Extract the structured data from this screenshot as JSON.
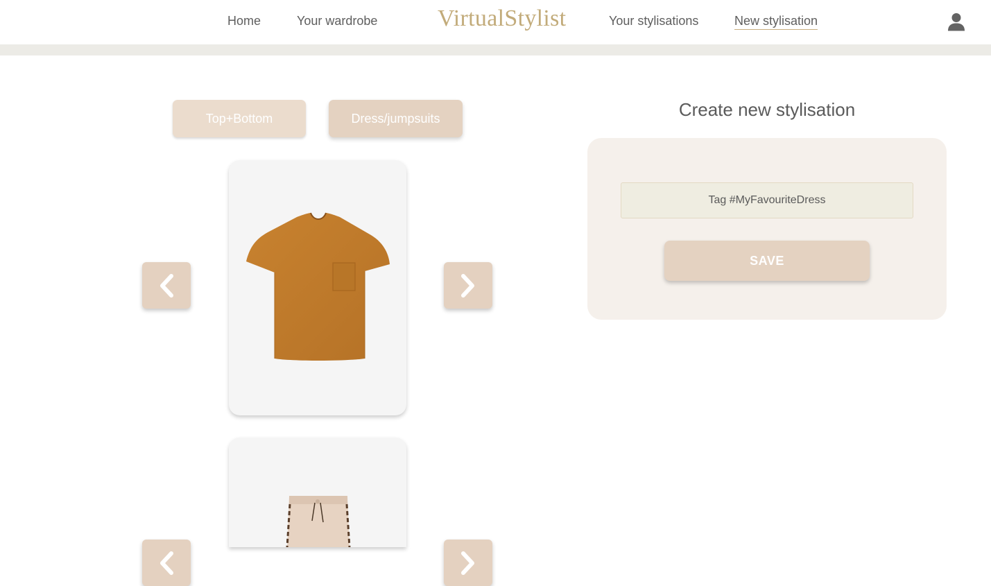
{
  "app": {
    "logo": "VirtualStylist"
  },
  "nav": {
    "home": "Home",
    "wardrobe": "Your wardrobe",
    "stylisations": "Your stylisations",
    "new_stylisation": "New stylisation",
    "active": "New stylisation",
    "user_icon": "user-icon"
  },
  "categories": {
    "top_bottom": "Top+Bottom",
    "dress": "Dress/jumpsuits"
  },
  "carousel": {
    "prev_icon": "chevron-left-icon",
    "next_icon": "chevron-right-icon",
    "items": [
      {
        "garment": "t-shirt",
        "color": "#c07a2c"
      },
      {
        "garment": "trousers",
        "color": "#e5cfbd"
      }
    ]
  },
  "panel": {
    "title": "Create new stylisation",
    "tag_placeholder": "Tag #MyFavouriteDress",
    "save_label": "SAVE"
  },
  "colors": {
    "accent": "#c2ab7a",
    "button": "#e4d2c1",
    "panel": "#f5f0eb",
    "input": "#efede1"
  }
}
